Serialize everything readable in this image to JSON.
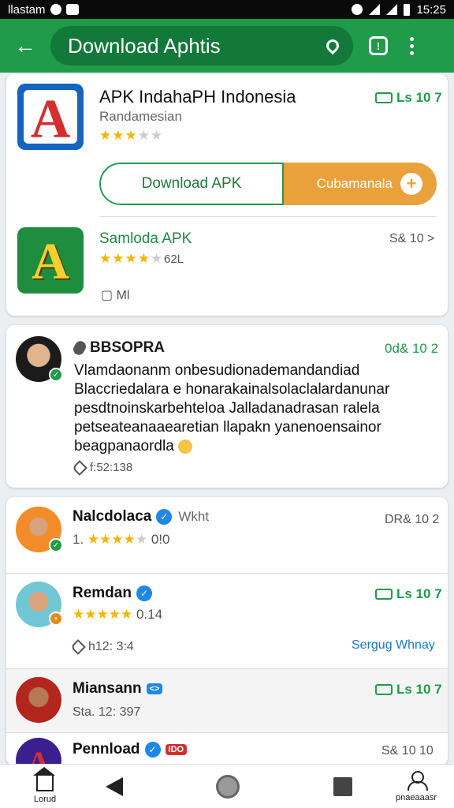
{
  "status_bar": {
    "left_text": "llastam",
    "time": "15:25"
  },
  "app_bar": {
    "search_text": "Download Aphtis"
  },
  "featured": {
    "title": "APK IndahaPH Indonesia",
    "subtitle": "Randamesian",
    "rating_stars": 3,
    "tag": "Ls 10 7",
    "download_label": "Download APK",
    "secondary_label": "Cubamanala",
    "related_title": "Samloda APK",
    "related_rating_stars": 4,
    "related_rating_count": "62L",
    "related_tag": "S& 10 >",
    "related_meta": "Ml",
    "colors": {
      "accent": "#1f9b4a",
      "orange": "#e9a23b",
      "blue": "#1e88e5"
    }
  },
  "review": {
    "author": "BBSOPRA",
    "tag": "0d& 10 2",
    "text": "Vlamdaonanm onbesudionademandandiad Blaccriedalara e honarakainalsolaclalardanunar pesdtnoinskarbehteloa Jalladanadrasan ralela petseateanaaearetian llapakn yanenoensainor beagpanaordla",
    "footer": "f:52:138"
  },
  "reviewers": [
    {
      "name": "Nalcdolaca",
      "extra": "Wkht",
      "rating_prefix": "1.",
      "rating_stars": 4,
      "rating_suffix": "0!0",
      "tag": "DR& 10 2"
    },
    {
      "name": "Remdan",
      "rating_stars": 5,
      "rating_suffix": "0.14",
      "tag": "Ls 10 7",
      "footer": "h12: 3:4",
      "link": "Sergug Whnay"
    },
    {
      "name": "Miansann",
      "badge": "<>",
      "meta": "Sta. 12: 397",
      "tag": "Ls 10 7"
    },
    {
      "name": "Pennload",
      "badge": "IDO",
      "tag": "S& 10 10"
    }
  ],
  "nav": {
    "home_label": "Lorud",
    "profile_label": "pnaeaaasr"
  },
  "icons": [
    "back-arrow-icon",
    "location-pin-icon",
    "shield-icon",
    "more-vert-icon",
    "check-icon",
    "verified-icon",
    "mic-icon",
    "heart-icon",
    "home-icon",
    "user-icon"
  ]
}
